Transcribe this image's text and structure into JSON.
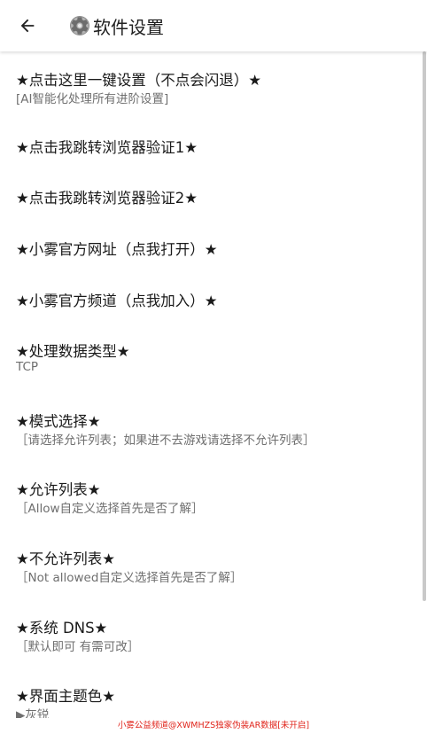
{
  "header": {
    "back_icon": "arrow-left-icon",
    "title_icon": "gear-icon",
    "title": "软件设置"
  },
  "colors": {
    "text_primary": "#1a1a1a",
    "text_secondary": "#6f6f6f",
    "footer_text": "#e0241b",
    "scrollbar": "#c9c9c9"
  },
  "items": [
    {
      "title": "★点击这里一键设置（不点会闪退）★",
      "summary": "[AI智能化处理所有进阶设置]"
    },
    {
      "title": "★点击我跳转浏览器验证1★",
      "summary": ""
    },
    {
      "title": "★点击我跳转浏览器验证2★",
      "summary": ""
    },
    {
      "title": "★小雾官方网址（点我打开）★",
      "summary": ""
    },
    {
      "title": "★小雾官方频道（点我加入）★",
      "summary": ""
    },
    {
      "title": "★处理数据类型★",
      "summary": "TCP"
    },
    {
      "title": "★模式选择★",
      "summary": "［请选择允许列表；如果进不去游戏请选择不允许列表］"
    },
    {
      "title": "★允许列表★",
      "summary": "［Allow自定义选择首先是否了解］"
    },
    {
      "title": "★不允许列表★",
      "summary": "［Not allowed自定义选择首先是否了解］"
    },
    {
      "title": "★系统 DNS★",
      "summary": "［默认即可 有需可改］"
    },
    {
      "title": "★界面主题色★",
      "summary": "▶灰锐"
    }
  ],
  "footer": {
    "text": "小雾公益频道@XWMHZS独家伪装AR数据[未开启]"
  }
}
